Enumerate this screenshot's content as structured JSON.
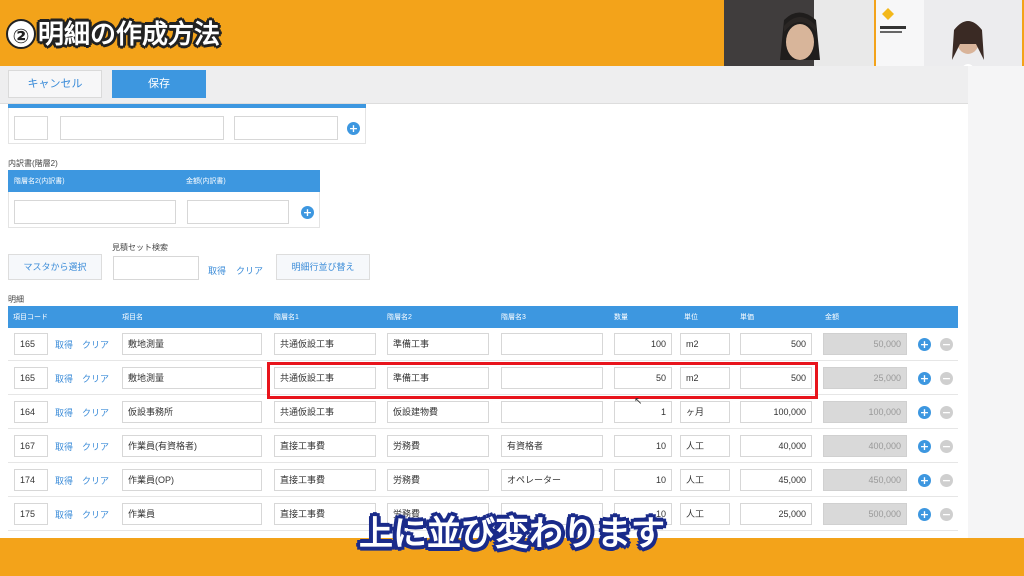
{
  "overlay": {
    "title_number": "②",
    "title_text": "明細の作成方法",
    "subtitle": "上に並び変わります"
  },
  "toolbar": {
    "cancel_label": "キャンセル",
    "save_label": "保存"
  },
  "breakdown": {
    "section_label": "内訳書(階層2)",
    "col_name": "階層名2(内訳書)",
    "col_amount": "金額(内訳書)"
  },
  "estimate_search": {
    "label": "見積セット検索",
    "master_button": "マスタから選択",
    "fetch_link": "取得",
    "clear_link": "クリア",
    "reorder_button": "明細行並び替え"
  },
  "details": {
    "section_label": "明細",
    "columns": [
      "項目コード",
      "項目名",
      "階層名1",
      "階層名2",
      "階層名3",
      "数量",
      "単位",
      "単価",
      "金額"
    ],
    "fetch_label": "取得",
    "clear_label": "クリア",
    "rows": [
      {
        "code": "165",
        "name": "敷地測量",
        "level1": "共通仮設工事",
        "level2": "準備工事",
        "level3": "",
        "qty": "100",
        "unit": "m2",
        "price": "500",
        "amount": "50,000"
      },
      {
        "code": "165",
        "name": "敷地測量",
        "level1": "共通仮設工事",
        "level2": "準備工事",
        "level3": "",
        "qty": "50",
        "unit": "m2",
        "price": "500",
        "amount": "25,000"
      },
      {
        "code": "164",
        "name": "仮設事務所",
        "level1": "共通仮設工事",
        "level2": "仮設建物費",
        "level3": "",
        "qty": "1",
        "unit": "ヶ月",
        "price": "100,000",
        "amount": "100,000"
      },
      {
        "code": "167",
        "name": "作業員(有資格者)",
        "level1": "直接工事費",
        "level2": "労務費",
        "level3": "有資格者",
        "qty": "10",
        "unit": "人工",
        "price": "40,000",
        "amount": "400,000"
      },
      {
        "code": "174",
        "name": "作業員(OP)",
        "level1": "直接工事費",
        "level2": "労務費",
        "level3": "オペレーター",
        "qty": "10",
        "unit": "人工",
        "price": "45,000",
        "amount": "450,000"
      },
      {
        "code": "175",
        "name": "作業員",
        "level1": "直接工事費",
        "level2": "労務費",
        "level3": "",
        "qty": "10",
        "unit": "人工",
        "price": "25,000",
        "amount": "500,000"
      }
    ]
  },
  "colors": {
    "accent": "#3d97e0",
    "frame": "#f3a31a",
    "highlight": "#e8141c"
  }
}
